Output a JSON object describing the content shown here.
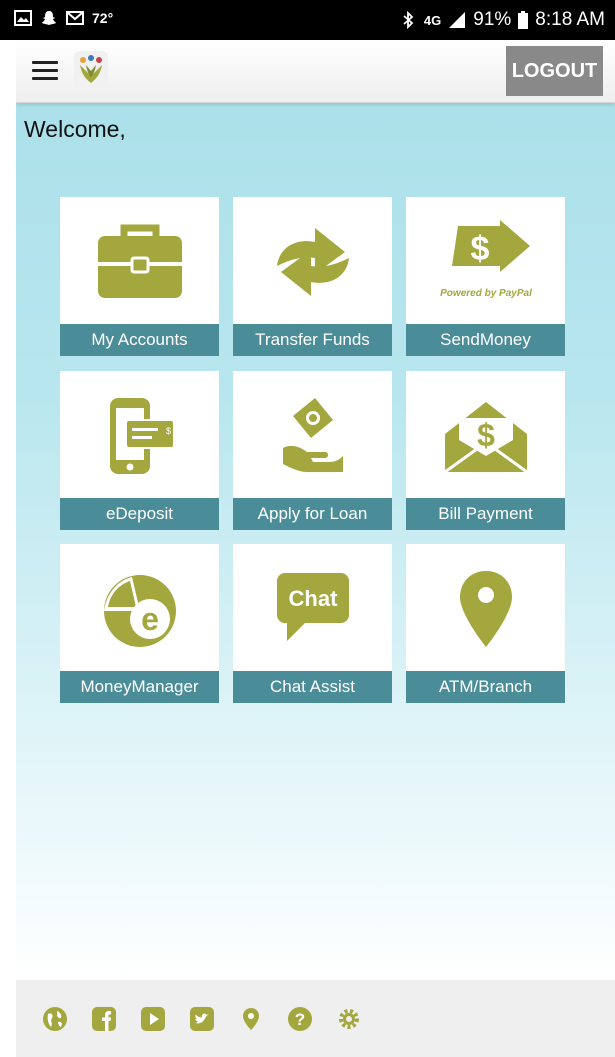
{
  "status_bar": {
    "temperature": "72°",
    "battery": "91%",
    "time": "8:18 AM",
    "network": "4G"
  },
  "header": {
    "logout_label": "LOGOUT"
  },
  "welcome_text": "Welcome,",
  "tiles": [
    {
      "label": "My Accounts",
      "icon": "briefcase-icon"
    },
    {
      "label": "Transfer Funds",
      "icon": "transfer-arrows-icon"
    },
    {
      "label": "SendMoney",
      "icon": "paypal-send-icon",
      "icon_text": "Powered by PayPal"
    },
    {
      "label": "eDeposit",
      "icon": "phone-check-icon"
    },
    {
      "label": "Apply for Loan",
      "icon": "hand-money-icon"
    },
    {
      "label": "Bill Payment",
      "icon": "envelope-dollar-icon"
    },
    {
      "label": "MoneyManager",
      "icon": "moneymanager-icon"
    },
    {
      "label": "Chat Assist",
      "icon": "chat-bubble-icon",
      "icon_text": "Chat"
    },
    {
      "label": "ATM/Branch",
      "icon": "map-pin-icon"
    }
  ],
  "footer_icons": [
    "globe-icon",
    "facebook-icon",
    "youtube-icon",
    "twitter-icon",
    "location-icon",
    "help-icon",
    "settings-icon"
  ],
  "colors": {
    "accent_olive": "#a3a73d",
    "label_teal": "#4b8c99",
    "logout_gray": "#898989",
    "bg_sky": "#a9dfe9"
  }
}
